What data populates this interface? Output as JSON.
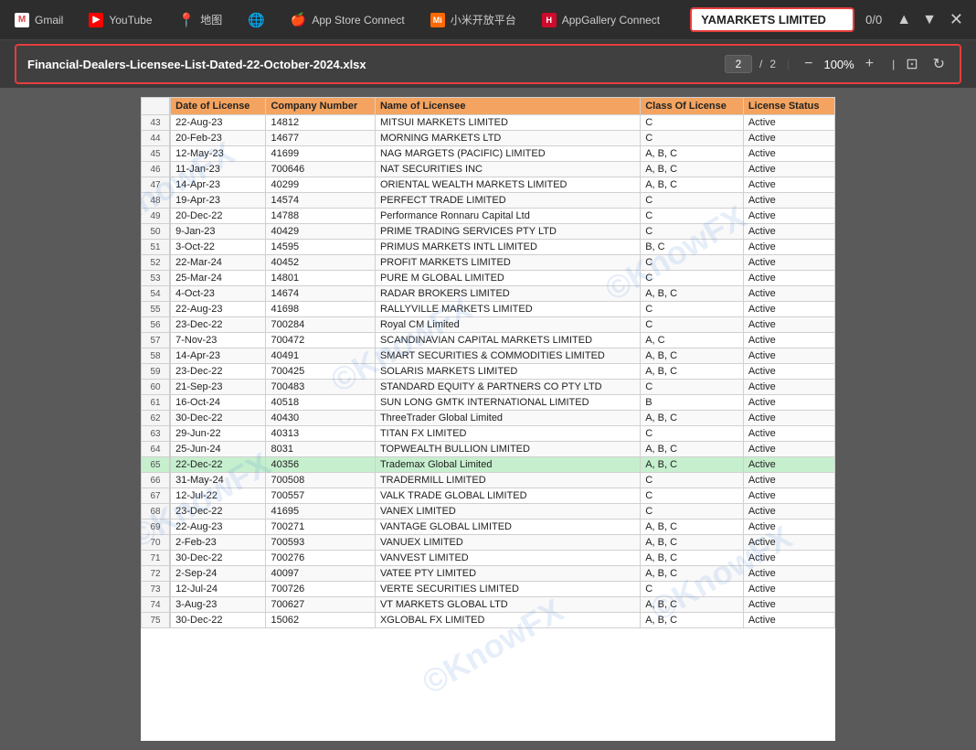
{
  "browser": {
    "tabs": [
      {
        "id": "gmail",
        "label": "Gmail",
        "icon": "G",
        "icon_type": "gmail"
      },
      {
        "id": "youtube",
        "label": "YouTube",
        "icon": "▶",
        "icon_type": "youtube"
      },
      {
        "id": "maps",
        "label": "地图",
        "icon": "📍",
        "icon_type": "maps"
      },
      {
        "id": "globe",
        "label": "",
        "icon": "🌐",
        "icon_type": "globe"
      },
      {
        "id": "appstore",
        "label": "App Store Connect",
        "icon": "",
        "icon_type": "apple"
      },
      {
        "id": "mi",
        "label": "小米开放平台",
        "icon": "Mi",
        "icon_type": "mi"
      },
      {
        "id": "huawei",
        "label": "AppGallery Connect",
        "icon": "H",
        "icon_type": "huawei"
      }
    ],
    "search_highlight": "YAMARKETS LIMITED",
    "page_count": "0/0",
    "nav_up": "▲",
    "nav_down": "▼",
    "close": "✕"
  },
  "pdf": {
    "filename": "Financial-Dealers-Licensee-List-Dated-22-October-2024.xlsx",
    "current_page": "2",
    "total_pages": "2",
    "zoom": "100%",
    "zoom_out": "−",
    "zoom_in": "+"
  },
  "table": {
    "headers": [
      "",
      "Date of License",
      "Company Number",
      "Name of Licensee",
      "Class Of License",
      "License Status"
    ],
    "rows": [
      {
        "num": "43",
        "date": "22-Aug-23",
        "company": "14812",
        "name": "MITSUI MARKETS LIMITED",
        "class": "C",
        "status": "Active"
      },
      {
        "num": "44",
        "date": "20-Feb-23",
        "company": "14677",
        "name": "MORNING MARKETS LTD",
        "class": "C",
        "status": "Active"
      },
      {
        "num": "45",
        "date": "12-May-23",
        "company": "41699",
        "name": "NAG MARGETS (PACIFIC) LIMITED",
        "class": "A, B, C",
        "status": "Active"
      },
      {
        "num": "46",
        "date": "11-Jan-23",
        "company": "700646",
        "name": "NAT SECURITIES INC",
        "class": "A, B, C",
        "status": "Active"
      },
      {
        "num": "47",
        "date": "14-Apr-23",
        "company": "40299",
        "name": "ORIENTAL WEALTH MARKETS LIMITED",
        "class": "A, B, C",
        "status": "Active"
      },
      {
        "num": "48",
        "date": "19-Apr-23",
        "company": "14574",
        "name": "PERFECT TRADE LIMITED",
        "class": "C",
        "status": "Active"
      },
      {
        "num": "49",
        "date": "20-Dec-22",
        "company": "14788",
        "name": "Performance Ronnaru Capital Ltd",
        "class": "C",
        "status": "Active"
      },
      {
        "num": "50",
        "date": "9-Jan-23",
        "company": "40429",
        "name": "PRIME TRADING SERVICES PTY LTD",
        "class": "C",
        "status": "Active"
      },
      {
        "num": "51",
        "date": "3-Oct-22",
        "company": "14595",
        "name": "PRIMUS MARKETS INTL LIMITED",
        "class": "B, C",
        "status": "Active"
      },
      {
        "num": "52",
        "date": "22-Mar-24",
        "company": "40452",
        "name": "PROFIT MARKETS LIMITED",
        "class": "C",
        "status": "Active"
      },
      {
        "num": "53",
        "date": "25-Mar-24",
        "company": "14801",
        "name": "PURE M GLOBAL LIMITED",
        "class": "C",
        "status": "Active"
      },
      {
        "num": "54",
        "date": "4-Oct-23",
        "company": "14674",
        "name": "RADAR BROKERS LIMITED",
        "class": "A, B, C",
        "status": "Active"
      },
      {
        "num": "55",
        "date": "22-Aug-23",
        "company": "41698",
        "name": "RALLYVILLE MARKETS LIMITED",
        "class": "C",
        "status": "Active"
      },
      {
        "num": "56",
        "date": "23-Dec-22",
        "company": "700284",
        "name": "Royal CM Limited",
        "class": "C",
        "status": "Active"
      },
      {
        "num": "57",
        "date": "7-Nov-23",
        "company": "700472",
        "name": "SCANDINAVIAN CAPITAL MARKETS LIMITED",
        "class": "A, C",
        "status": "Active"
      },
      {
        "num": "58",
        "date": "14-Apr-23",
        "company": "40491",
        "name": "SMART SECURITIES & COMMODITIES LIMITED",
        "class": "A, B, C",
        "status": "Active"
      },
      {
        "num": "59",
        "date": "23-Dec-22",
        "company": "700425",
        "name": "SOLARIS MARKETS LIMITED",
        "class": "A, B, C",
        "status": "Active"
      },
      {
        "num": "60",
        "date": "21-Sep-23",
        "company": "700483",
        "name": "STANDARD EQUITY & PARTNERS CO PTY LTD",
        "class": "C",
        "status": "Active"
      },
      {
        "num": "61",
        "date": "16-Oct-24",
        "company": "40518",
        "name": "SUN LONG GMTK INTERNATIONAL LIMITED",
        "class": "B",
        "status": "Active"
      },
      {
        "num": "62",
        "date": "30-Dec-22",
        "company": "40430",
        "name": "ThreeTrader Global Limited",
        "class": "A, B, C",
        "status": "Active"
      },
      {
        "num": "63",
        "date": "29-Jun-22",
        "company": "40313",
        "name": "TITAN FX LIMITED",
        "class": "C",
        "status": "Active"
      },
      {
        "num": "64",
        "date": "25-Jun-24",
        "company": "8031",
        "name": "TOPWEALTH BULLION LIMITED",
        "class": "A, B, C",
        "status": "Active"
      },
      {
        "num": "65",
        "date": "22-Dec-22",
        "company": "40356",
        "name": "Trademax Global Limited",
        "class": "A, B, C",
        "status": "Active",
        "highlight": true
      },
      {
        "num": "66",
        "date": "31-May-24",
        "company": "700508",
        "name": "TRADERMILL LIMITED",
        "class": "C",
        "status": "Active"
      },
      {
        "num": "67",
        "date": "12-Jul-22",
        "company": "700557",
        "name": "VALK TRADE GLOBAL LIMITED",
        "class": "C",
        "status": "Active"
      },
      {
        "num": "68",
        "date": "23-Dec-22",
        "company": "41695",
        "name": "VANEX LIMITED",
        "class": "C",
        "status": "Active"
      },
      {
        "num": "69",
        "date": "22-Aug-23",
        "company": "700271",
        "name": "VANTAGE GLOBAL LIMITED",
        "class": "A, B, C",
        "status": "Active"
      },
      {
        "num": "70",
        "date": "2-Feb-23",
        "company": "700593",
        "name": "VANUEX LIMITED",
        "class": "A, B, C",
        "status": "Active"
      },
      {
        "num": "71",
        "date": "30-Dec-22",
        "company": "700276",
        "name": "VANVEST LIMITED",
        "class": "A, B, C",
        "status": "Active"
      },
      {
        "num": "72",
        "date": "2-Sep-24",
        "company": "40097",
        "name": "VATEE PTY LIMITED",
        "class": "A, B, C",
        "status": "Active"
      },
      {
        "num": "73",
        "date": "12-Jul-24",
        "company": "700726",
        "name": "VERTE SECURITIES LIMITED",
        "class": "C",
        "status": "Active"
      },
      {
        "num": "74",
        "date": "3-Aug-23",
        "company": "700627",
        "name": "VT MARKETS GLOBAL LTD",
        "class": "A, B, C",
        "status": "Active"
      },
      {
        "num": "75",
        "date": "30-Dec-22",
        "company": "15062",
        "name": "XGLOBAL FX LIMITED",
        "class": "A, B, C",
        "status": "Active"
      }
    ]
  },
  "watermark": {
    "text": "KnowFX"
  }
}
